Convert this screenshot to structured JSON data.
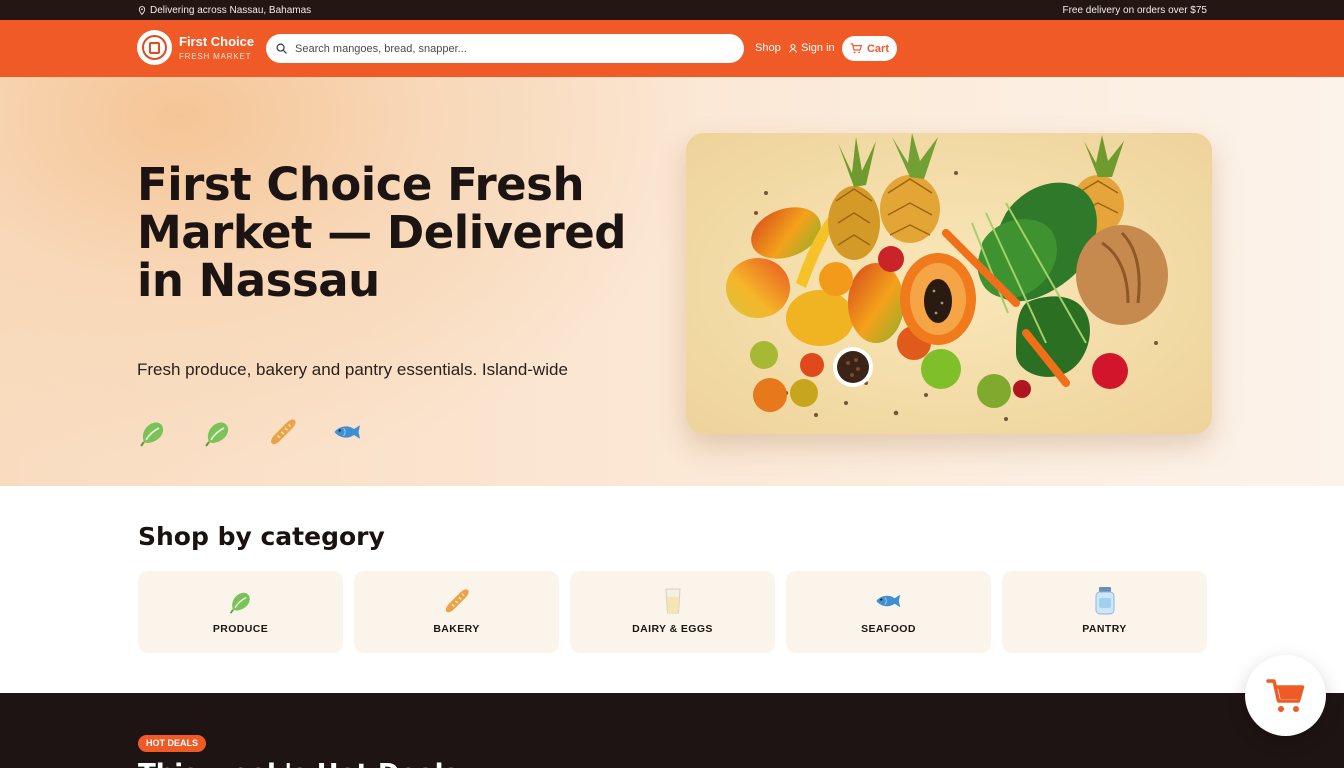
{
  "topbar": {
    "location_icon": "map-pin-icon",
    "location_text": "Delivering across Nassau, Bahamas",
    "promo_text": "Free delivery on orders over $75"
  },
  "header": {
    "logo_icon": "brand-seal-logo",
    "brand_name": "First Choice",
    "brand_subtitle": "FRESH MARKET",
    "search_icon": "search-icon",
    "search_placeholder": "Search mangoes, bread, snapper...",
    "search_value": "",
    "nav_shop": "Shop",
    "signin_icon": "user-icon",
    "nav_signin": "Sign in",
    "cart_icon": "cart-icon",
    "cart_label": "Cart"
  },
  "hero": {
    "title": "First Choice Fresh Market — Delivered in Nassau",
    "subtitle": "Fresh produce, bakery and pantry essentials. Island-wide",
    "icons": [
      "leafy-greens-icon",
      "leafy-greens-icon",
      "baguette-icon",
      "fish-icon"
    ],
    "image_subject": "fresh-produce-spread"
  },
  "categories": {
    "heading": "Shop by category",
    "items": [
      {
        "label": "PRODUCE",
        "icon": "leafy-greens-icon"
      },
      {
        "label": "BAKERY",
        "icon": "baguette-icon"
      },
      {
        "label": "DAIRY & EGGS",
        "icon": "milk-glass-icon"
      },
      {
        "label": "SEAFOOD",
        "icon": "fish-icon"
      },
      {
        "label": "PANTRY",
        "icon": "jar-icon"
      }
    ]
  },
  "deals": {
    "badge": "HOT DEALS",
    "title": "This week's Hot Deals"
  },
  "floating_cart": {
    "icon": "cart-icon"
  },
  "colors": {
    "brand_orange": "#ef5a26",
    "topbar_dark": "#241613",
    "deals_dark": "#1e1413",
    "card_cream": "#fbf4ea"
  }
}
